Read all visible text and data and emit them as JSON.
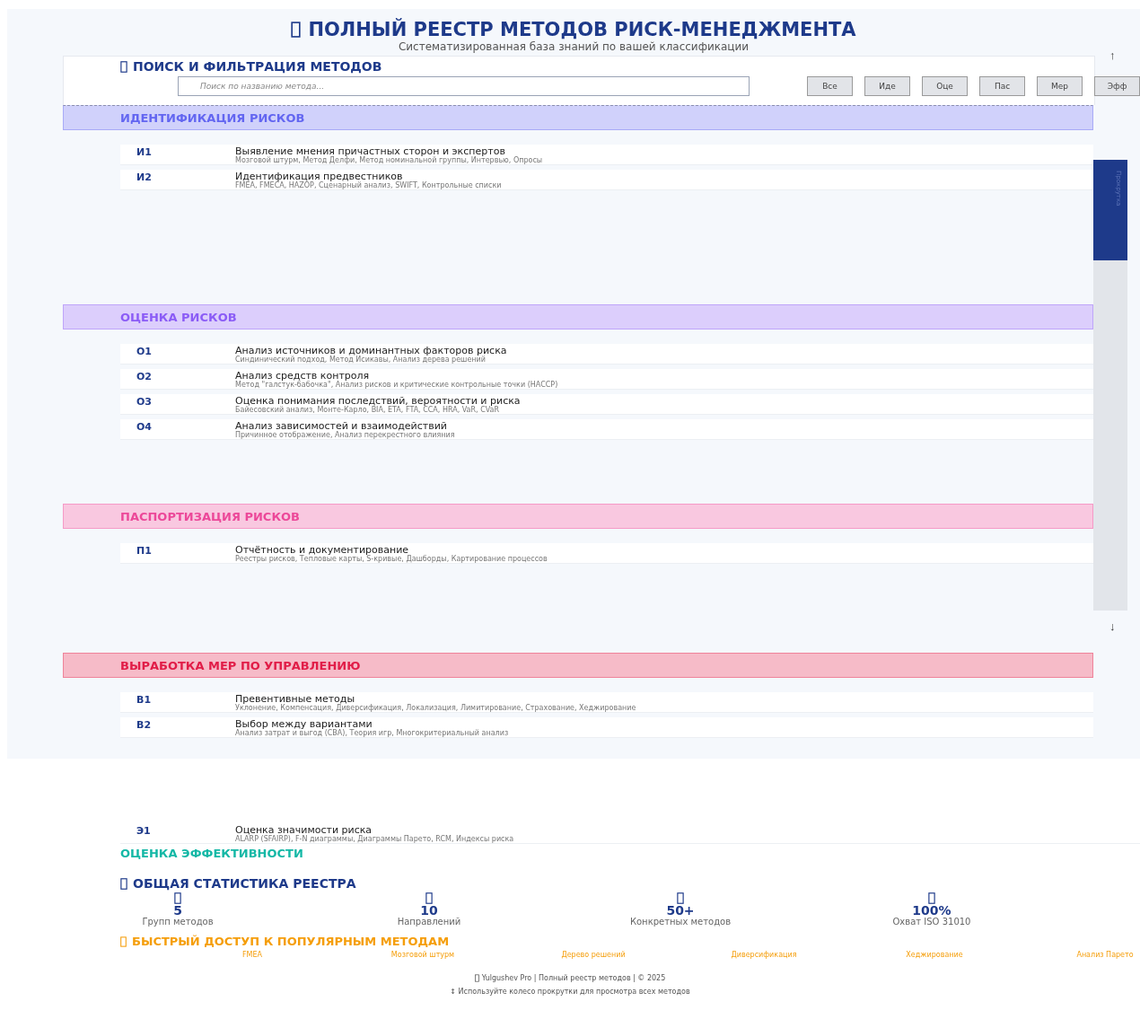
{
  "header": {
    "title": "ПОЛНЫЙ РЕЕСТР МЕТОДОВ РИСК-МЕНЕДЖМЕНТА",
    "subtitle": "Систематизированная база знаний по вашей классификации"
  },
  "search": {
    "title": "ПОИСК И ФИЛЬТРАЦИЯ МЕТОДОВ",
    "placeholder": "Поиск по названию метода...",
    "filters": [
      {
        "label": "Все",
        "selected": false
      },
      {
        "label": "Иде",
        "selected": false
      },
      {
        "label": "Оце",
        "selected": false
      },
      {
        "label": "Пас",
        "selected": false
      },
      {
        "label": "Мер",
        "selected": false
      },
      {
        "label": "Эфф",
        "selected": false
      }
    ]
  },
  "scroll": {
    "up": "↑",
    "down": "↓",
    "thumb_label": "Прокрутка"
  },
  "groups": [
    {
      "title": "ИДЕНТИФИКАЦИЯ РИСКОВ",
      "color": "#6366f1",
      "methods": [
        {
          "code": "И1",
          "name": "Выявление мнения причастных сторон и экспертов",
          "tools": "Мозговой штурм, Метод Делфи, Метод номинальной группы, Интервью, Опросы"
        },
        {
          "code": "И2",
          "name": "Идентификация предвестников",
          "tools": "FMEA, FMECA, HAZOP, Сценарный анализ, SWIFT, Контрольные списки"
        }
      ]
    },
    {
      "title": "ОЦЕНКА РИСКОВ",
      "color": "#8b5cf6",
      "methods": [
        {
          "code": "О1",
          "name": "Анализ источников и доминантных факторов риска",
          "tools": "Синдинический подход, Метод Исикавы, Анализ дерева решений"
        },
        {
          "code": "О2",
          "name": "Анализ средств контроля",
          "tools": "Метод \"галстук-бабочка\", Анализ рисков и критические контрольные точки (HACCP)"
        },
        {
          "code": "О3",
          "name": "Оценка понимания последствий, вероятности и риска",
          "tools": "Байесовский анализ, Монте-Карло, BIA, ETA, FTA, CCA, HRA, VaR, CVaR"
        },
        {
          "code": "О4",
          "name": "Анализ зависимостей и взаимодействий",
          "tools": "Причинное отображение, Анализ перекрестного влияния"
        }
      ]
    },
    {
      "title": "ПАСПОРТИЗАЦИЯ РИСКОВ",
      "color": "#ec4899",
      "methods": [
        {
          "code": "П1",
          "name": "Отчётность и документирование",
          "tools": "Реестры рисков, Тепловые карты, S-кривые, Дашборды, Картирование процессов"
        }
      ]
    },
    {
      "title": "ВЫРАБОТКА МЕР ПО УПРАВЛЕНИЮ",
      "color": "#e11d48",
      "methods": [
        {
          "code": "В1",
          "name": "Превентивные методы",
          "tools": "Уклонение, Компенсация, Диверсификация, Локализация, Лимитирование, Страхование, Хеджирование"
        },
        {
          "code": "В2",
          "name": "Выбор между вариантами",
          "tools": "Анализ затрат и выгод (CBA), Теория игр, Многокритериальный анализ"
        }
      ]
    }
  ],
  "overflow_group": {
    "title": "ОЦЕНКА ЭФФЕКТИВНОСТИ",
    "color": "#14b8a6",
    "methods": [
      {
        "code": "Э1",
        "name": "Оценка значимости риска",
        "tools": "ALARP (SFAIRP), F-N диаграммы, Диаграммы Парето, RCM, Индексы риска"
      }
    ]
  },
  "stats": {
    "title": "ОБЩАЯ СТАТИСТИКА РЕЕСТРА",
    "items": [
      {
        "value": "5",
        "label": "Групп методов"
      },
      {
        "value": "10",
        "label": "Направлений"
      },
      {
        "value": "50+",
        "label": "Конкретных методов"
      },
      {
        "value": "100%",
        "label": "Охват ISO 31010"
      }
    ]
  },
  "quick": {
    "title": "БЫСТРЫЙ ДОСТУП К ПОПУЛЯРНЫМ МЕТОДАМ",
    "links": [
      "FMEA",
      "Мозговой штурм",
      "Дерево решений",
      "Диверсификация",
      "Хеджирование",
      "Анализ Парето"
    ]
  },
  "footer": {
    "credits": "Yulgushev Pro | Полный реестр методов | © 2025",
    "hint": "↕ Используйте колесо прокрутки для просмотра всех методов"
  }
}
